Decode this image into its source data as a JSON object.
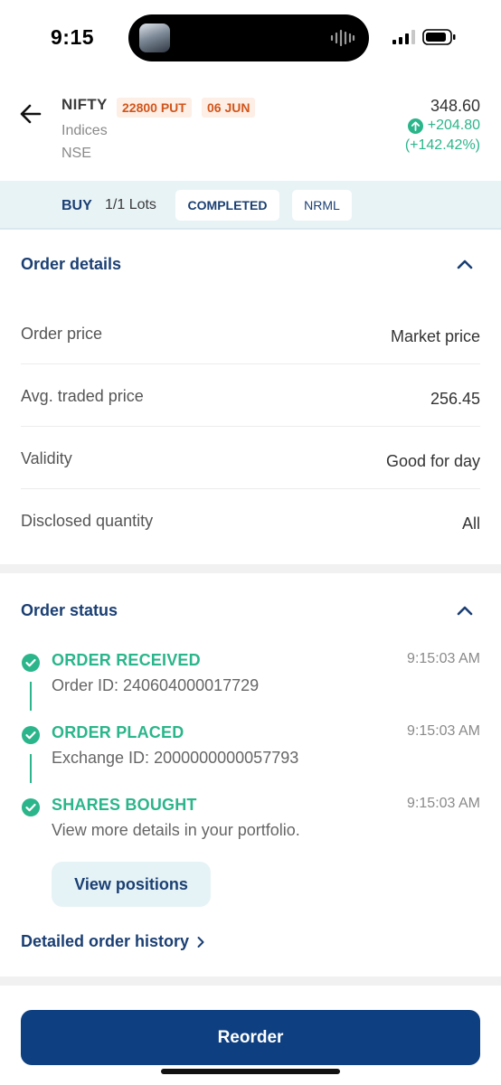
{
  "status_bar": {
    "time": "9:15"
  },
  "header": {
    "symbol": "NIFTY",
    "strike_chip": "22800 PUT",
    "expiry_chip": "06 JUN",
    "segment": "Indices",
    "exchange": "NSE",
    "ltp": "348.60",
    "change": "+204.80",
    "change_pct": "(+142.42%)"
  },
  "summary": {
    "side": "BUY",
    "lots": "1/1 Lots",
    "status": "COMPLETED",
    "product": "NRML"
  },
  "order_details": {
    "title": "Order details",
    "rows": [
      {
        "label": "Order price",
        "value": "Market price"
      },
      {
        "label": "Avg. traded price",
        "value": "256.45"
      },
      {
        "label": "Validity",
        "value": "Good for day"
      },
      {
        "label": "Disclosed quantity",
        "value": "All"
      }
    ]
  },
  "order_status": {
    "title": "Order status",
    "steps": [
      {
        "title": "ORDER RECEIVED",
        "sub": "Order ID: 240604000017729",
        "time": "9:15:03 AM"
      },
      {
        "title": "ORDER PLACED",
        "sub": "Exchange ID: 2000000000057793",
        "time": "9:15:03 AM"
      },
      {
        "title": "SHARES BOUGHT",
        "sub": "View more details in your portfolio.",
        "time": "9:15:03 AM"
      }
    ],
    "view_positions_label": "View positions",
    "history_link_label": "Detailed order history"
  },
  "footer": {
    "reorder_label": "Reorder"
  },
  "colors": {
    "primary": "#0e3f80",
    "success": "#2bb58a",
    "chip_text": "#d1561b",
    "strip_bg": "#e8f3f6"
  }
}
